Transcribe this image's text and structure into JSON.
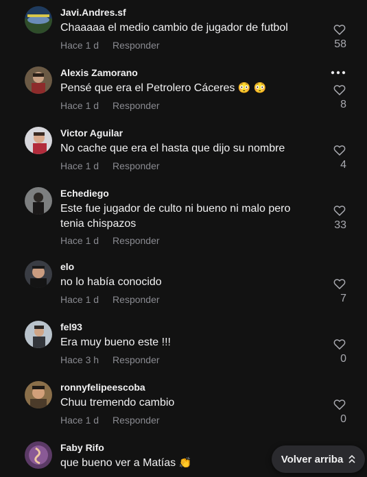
{
  "comments": [
    {
      "user": "Javi.Andres.sf",
      "text": "Chaaaaa el medio cambio de jugador de futbol",
      "time": "Hace 1 d",
      "reply": "Responder",
      "likes": "58"
    },
    {
      "user": "Alexis Zamorano",
      "text": "Pensé que era el Petrolero Cáceres",
      "emoji": "😳 😳",
      "time": "Hace 1 d",
      "reply": "Responder",
      "likes": "8"
    },
    {
      "user": "Victor Aguilar",
      "text": "No cache que era el hasta que dijo su nombre",
      "time": "Hace 1 d",
      "reply": "Responder",
      "likes": "4"
    },
    {
      "user": "Echediego",
      "text": "Este fue jugador de culto ni bueno ni malo pero tenia chispazos",
      "time": "Hace 1 d",
      "reply": "Responder",
      "likes": "33"
    },
    {
      "user": "elo",
      "text": "no lo había conocido",
      "time": "Hace 1 d",
      "reply": "Responder",
      "likes": "7"
    },
    {
      "user": "fel93",
      "text": "Era muy bueno este !!!",
      "time": "Hace 3 h",
      "reply": "Responder",
      "likes": "0"
    },
    {
      "user": "ronnyfelipeescoba",
      "text": "Chuu tremendo cambio",
      "time": "Hace 1 d",
      "reply": "Responder",
      "likes": "0"
    },
    {
      "user": "Faby Rifo",
      "text": "que bueno ver a Matías",
      "emoji": "👏",
      "time": "",
      "reply": "",
      "likes": ""
    }
  ],
  "back_to_top": "Volver arriba",
  "icons": {
    "like": "heart-outline-icon",
    "more": "more-horizontal-icon",
    "back": "chevron-up-icon"
  }
}
